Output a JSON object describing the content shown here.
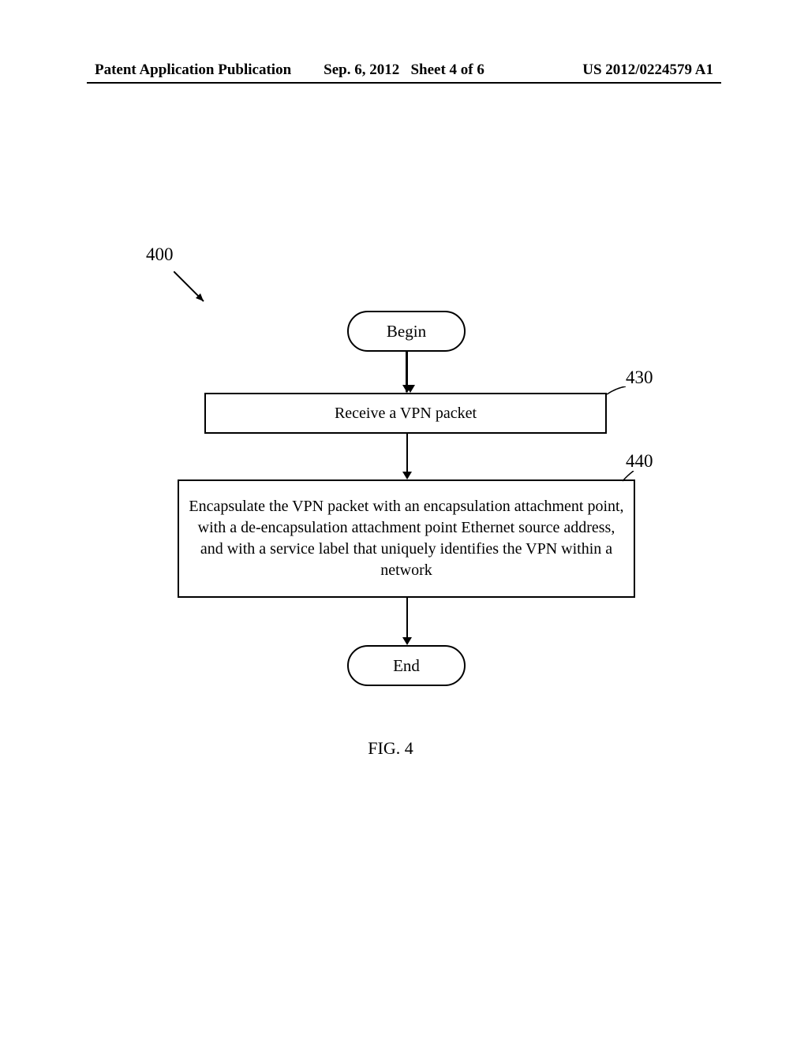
{
  "header": {
    "left": "Patent Application Publication",
    "date": "Sep. 6, 2012",
    "sheet": "Sheet 4 of 6",
    "pubno": "US 2012/0224579 A1"
  },
  "refs": {
    "r400": "400",
    "r430": "430",
    "r440": "440"
  },
  "flowchart": {
    "begin": "Begin",
    "step430": "Receive a VPN packet",
    "step440": "Encapsulate the VPN packet with an encapsulation attachment point, with a de-encapsulation attachment point Ethernet source address, and with a service label that uniquely identifies the VPN within a network",
    "end": "End"
  },
  "figure_label": "FIG. 4"
}
